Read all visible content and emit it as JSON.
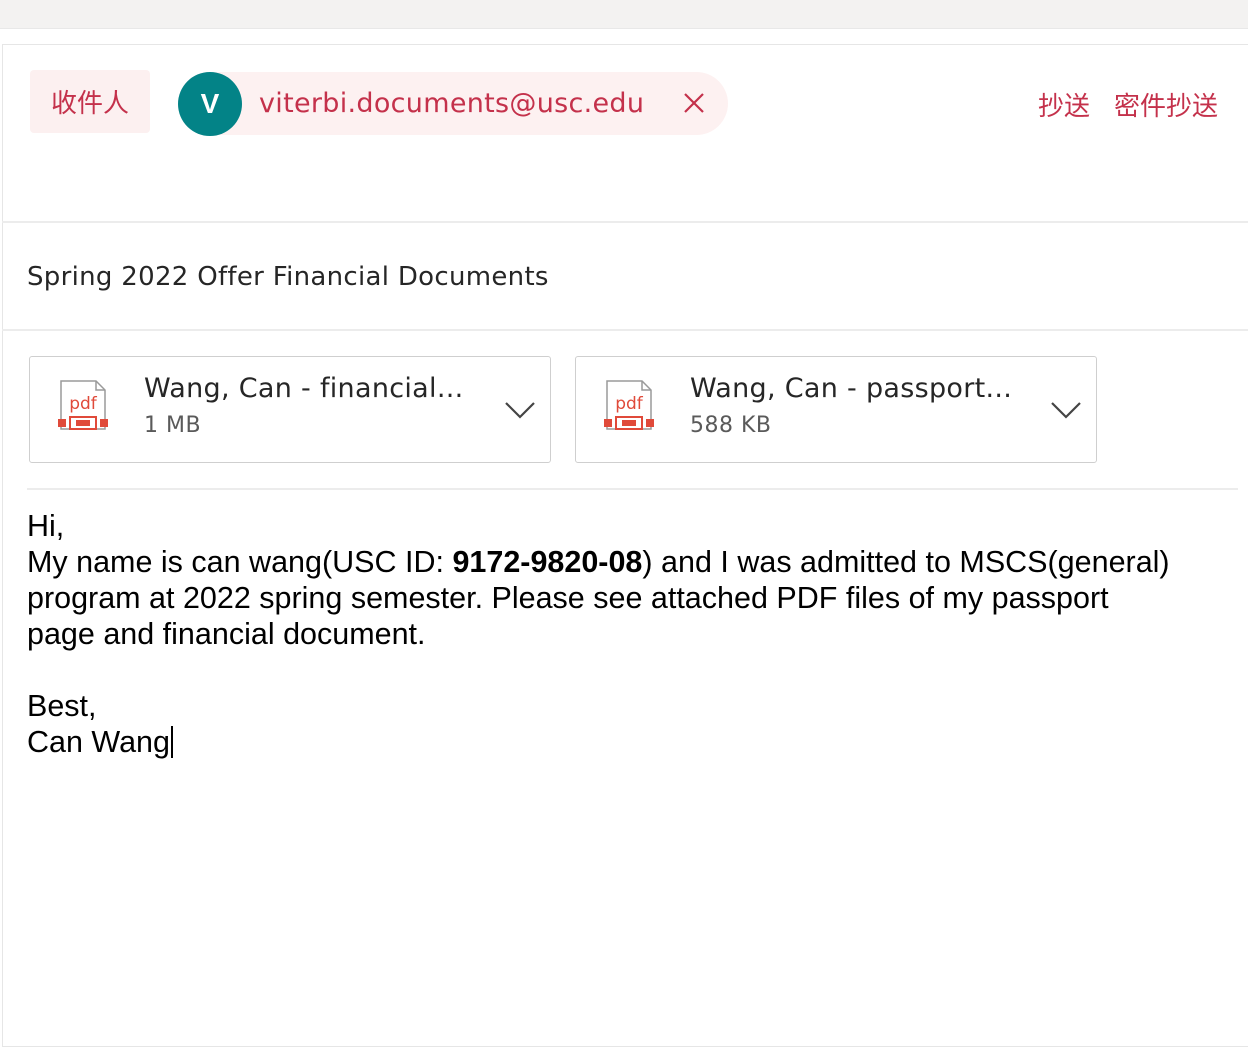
{
  "recipients": {
    "to_label": "收件人",
    "to_chip": {
      "avatar_letter": "V",
      "email": "viterbi.documents@usc.edu"
    },
    "cc_label": "抄送",
    "bcc_label": "密件抄送"
  },
  "subject": "Spring 2022 Offer Financial Documents",
  "attachments": [
    {
      "name": "Wang, Can - financial...",
      "size": "1 MB",
      "icon": "pdf-icon"
    },
    {
      "name": "Wang, Can - passport...",
      "size": "588 KB",
      "icon": "pdf-icon"
    }
  ],
  "body": {
    "greeting": "Hi,",
    "line1_pre": "My name is can wang(USC ID: ",
    "usc_id": "9172-9820-08",
    "line1_post": ") and I was admitted to MSCS(general)",
    "line2": "program at 2022 spring semester. Please see attached PDF files of my passport",
    "line3": "page and financial document.",
    "closing": "Best,",
    "signature": "Can Wang"
  },
  "colors": {
    "accent": "#c4314b",
    "avatar_bg": "#038387",
    "pdf_red": "#e04a3a"
  }
}
